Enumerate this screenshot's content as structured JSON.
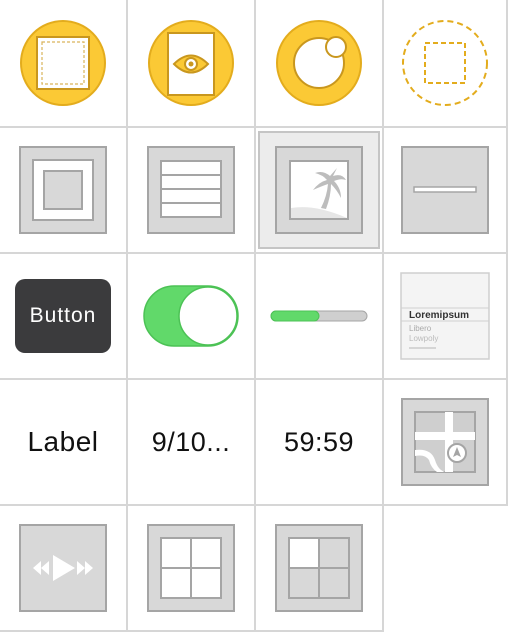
{
  "palette": {
    "items": [
      {
        "id": "view",
        "icon": "view-controller-icon"
      },
      {
        "id": "preview",
        "icon": "eye-document-icon"
      },
      {
        "id": "group",
        "icon": "group-circle-icon"
      },
      {
        "id": "placeholder",
        "icon": "dashed-square-icon"
      },
      {
        "id": "container",
        "icon": "nested-square-icon"
      },
      {
        "id": "table",
        "icon": "table-rows-icon"
      },
      {
        "id": "image",
        "icon": "image-palm-icon",
        "selected": true
      },
      {
        "id": "separator",
        "icon": "separator-line-icon"
      },
      {
        "id": "button",
        "label": "Button"
      },
      {
        "id": "switch",
        "icon": "toggle-switch-icon",
        "on": true
      },
      {
        "id": "slider",
        "icon": "slider-icon",
        "value": 0.5
      },
      {
        "id": "text",
        "icon": "text-block-icon",
        "lines": [
          "Loremipsum",
          "Libero",
          "Lowpoly"
        ]
      },
      {
        "id": "label",
        "label": "Label"
      },
      {
        "id": "page-indicator",
        "label": "9/10..."
      },
      {
        "id": "timer",
        "label": "59:59"
      },
      {
        "id": "map",
        "icon": "map-icon"
      },
      {
        "id": "movie",
        "icon": "media-controls-icon"
      },
      {
        "id": "grid",
        "icon": "grid-icon"
      },
      {
        "id": "grid-partial",
        "icon": "grid-partial-icon"
      }
    ]
  },
  "colors": {
    "yellow": "#fbc935",
    "yellow_stroke": "#e3ac1d",
    "gray_fill": "#d8d8d8",
    "gray_stroke": "#a5a5a5",
    "switch_green": "#61d96a",
    "button_dark": "#3b3b3d"
  }
}
